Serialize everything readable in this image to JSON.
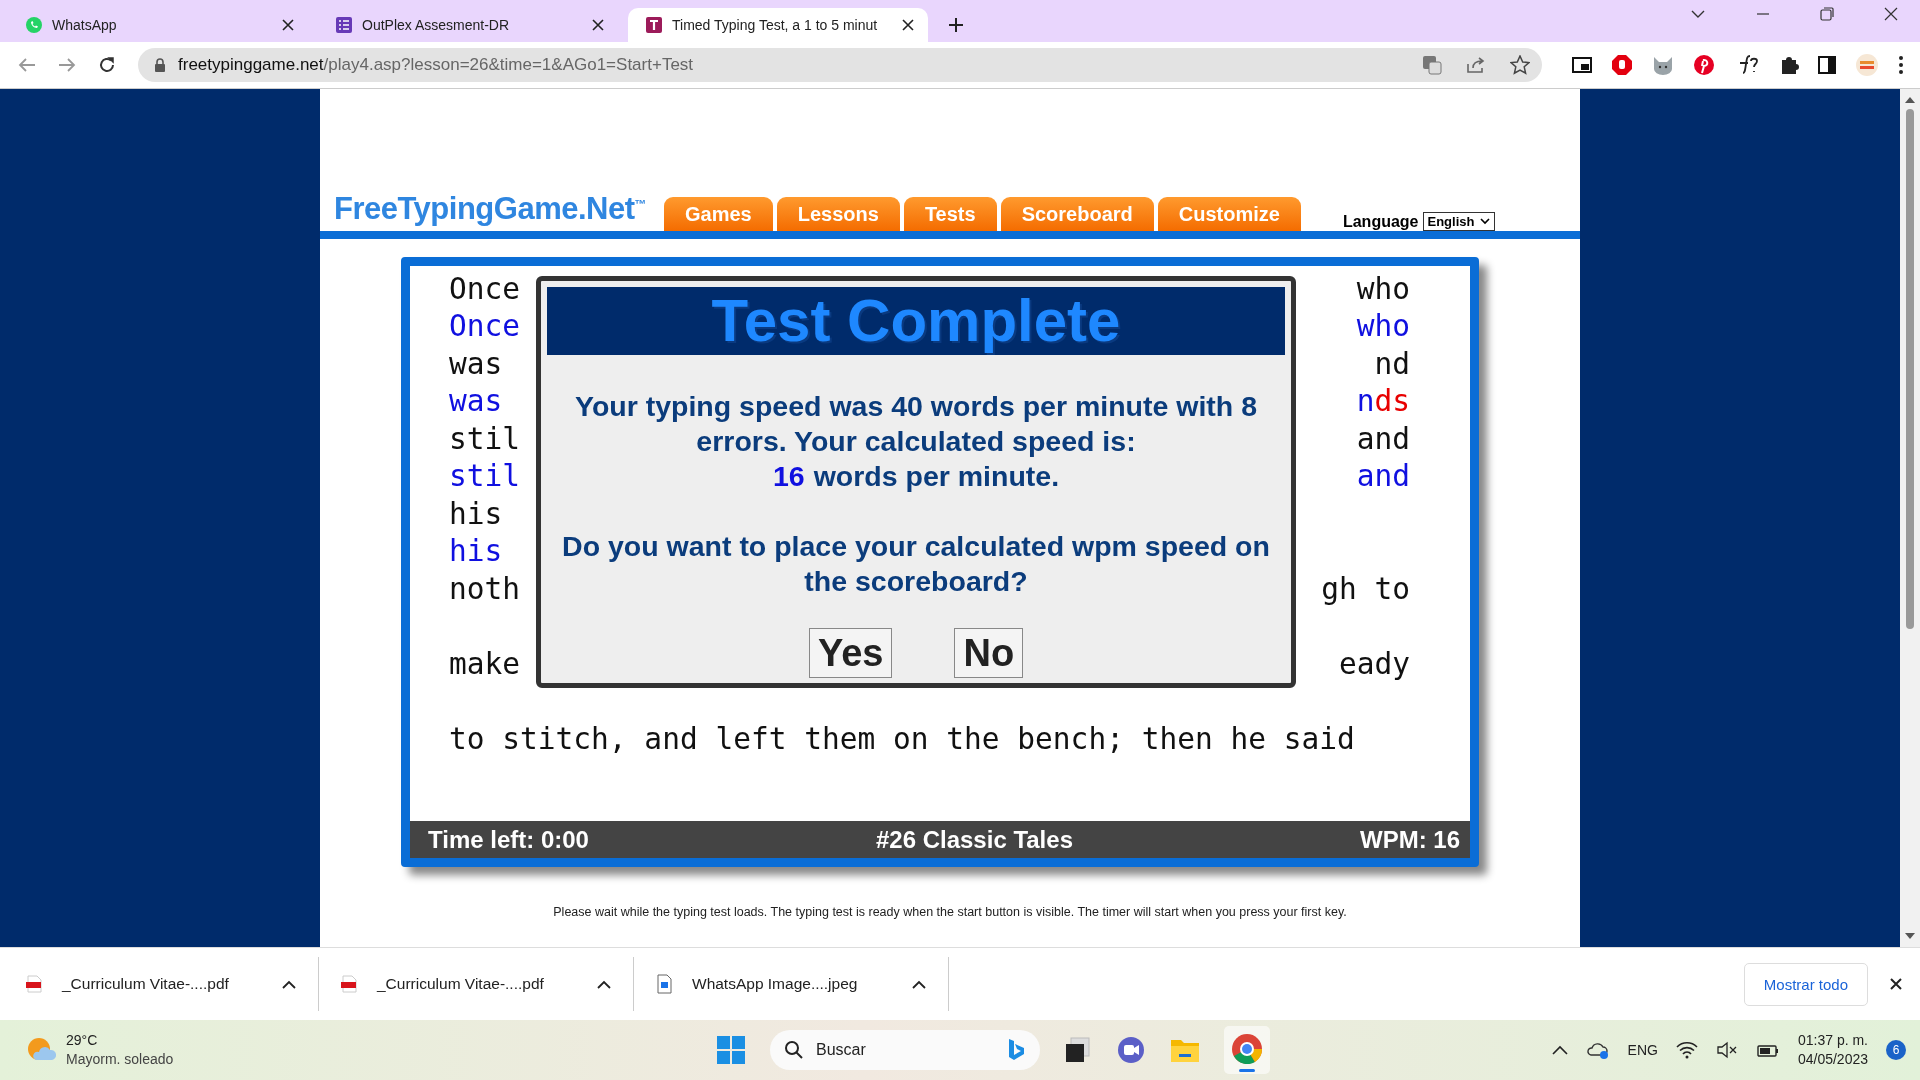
{
  "browser": {
    "tabs": [
      {
        "title": "WhatsApp",
        "selected": false
      },
      {
        "title": "OutPlex Assesment-DR",
        "selected": false
      },
      {
        "title": "Timed Typing Test, a 1 to 5 minut",
        "selected": true
      }
    ],
    "url_host": "freetypinggame.net",
    "url_path": "/play4.asp?lesson=26&time=1&AGo1=Start+Test"
  },
  "site": {
    "logo": "FreeTypingGame.Net$^{™}$",
    "nav": [
      "Games",
      "Lessons",
      "Tests",
      "Scoreboard",
      "Customize"
    ],
    "language_label": "Language",
    "language_value": "English"
  },
  "typing": {
    "rows": [
      {
        "left": "Once",
        "right": [
          {
            "text": "who",
            "error": false
          }
        ],
        "typed": {
          "left": "Once",
          "right": [
            {
              "text": "who",
              "error": false
            }
          ]
        }
      },
      {
        "left": "was",
        "right": [
          {
            "text": "nd",
            "error": false
          }
        ],
        "typed": {
          "left": "was",
          "right": [
            {
              "text": "n",
              "error": false
            },
            {
              "text": "ds",
              "error": true
            }
          ]
        }
      },
      {
        "left": "stil",
        "right": [
          {
            "text": "and",
            "error": false
          }
        ],
        "typed": {
          "left": "stil",
          "right": [
            {
              "text": "and",
              "error": false
            }
          ]
        }
      },
      {
        "left": "his",
        "typed": {
          "left": "his"
        }
      },
      {
        "left": "noth",
        "right": [
          {
            "text": "gh to",
            "error": false
          }
        ]
      },
      {
        "left": "make",
        "right": [
          {
            "text": "eady",
            "error": false
          }
        ]
      },
      {
        "left": "to stitch, and left them on the bench; then he said"
      }
    ],
    "status": {
      "time_left": "Time left: 0:00",
      "lesson": "#26 Classic Tales",
      "wpm": "WPM: 16"
    }
  },
  "dialog": {
    "title": "Test Complete",
    "message": "Your typing speed was 40 words per minute with 8 errors. Your calculated speed is:",
    "result_number": "16",
    "result_text": "words per minute.",
    "question": "Do you want to place your calculated wpm speed on the scoreboard?",
    "buttons": [
      "Yes",
      "No"
    ]
  },
  "note": "Please wait while the typing test loads. The typing test is ready when the start button is visible. The timer will start when you press your first key.",
  "downloads": {
    "items": [
      {
        "name": "_Curriculum Vitae-....pdf",
        "kind": "pdf"
      },
      {
        "name": "_Curriculum Vitae-....pdf",
        "kind": "pdf"
      },
      {
        "name": "WhatsApp Image....jpeg",
        "kind": "image"
      }
    ],
    "show_all": "Mostrar todo"
  },
  "taskbar": {
    "weather_temp": "29°C",
    "weather_text": "Mayorm. soleado",
    "search_placeholder": "Buscar",
    "language": "ENG",
    "time": "01:37 p. m.",
    "date": "04/05/2023",
    "notification_count": "6"
  }
}
